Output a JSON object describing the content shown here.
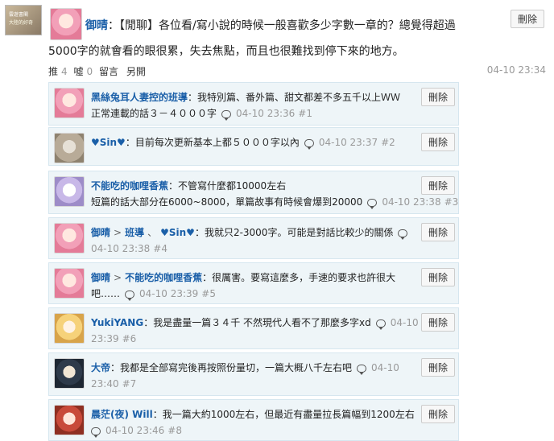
{
  "post": {
    "thumb_line1": "雲遊書閣",
    "thumb_line2": "大陸的好奇",
    "author": "御晴",
    "text1": "：【閒聊】各位看/寫小說的時候一般喜歡多少字數一章的？總覺得超過",
    "text2": "5000字的就會看的眼很累，失去焦點，而且也很難找到停下來的地方。",
    "push_label": "推",
    "push_count": "4",
    "boo_label": "噓",
    "boo_count": "0",
    "comment_label": "留言",
    "reply_label": "另開",
    "time": "04-10 23:34",
    "delete_label": "刪除"
  },
  "replies": [
    {
      "author": "黑絲兔耳人妻控的班導",
      "text": "：我特別篇、番外篇、甜文都差不多五千以上ＷＷ",
      "text2": "正常連載的話３－４０００字",
      "time": "04-10 23:36",
      "floor": "#1",
      "delete": "刪除"
    },
    {
      "author": "♥Sin♥",
      "text": "：目前每次更新基本上都５０００字以內",
      "time": "04-10 23:37",
      "floor": "#2",
      "delete": "刪除"
    },
    {
      "author": "不能吃的咖哩香蕉",
      "text": "：不管寫什麼都10000左右",
      "text2": "短篇的話大部分在6000~8000，單篇故事有時候會爆到20000",
      "time": "04-10 23:38",
      "floor": "#3",
      "delete": "刪除"
    },
    {
      "author": "御晴",
      "sep": ">",
      "to1": "班導",
      "to2": "♥Sin♥",
      "text": "：我就只2-3000字。可能是對話比較少的關係",
      "time": "04-10 23:38",
      "floor": "#4",
      "delete": "刪除"
    },
    {
      "author": "御晴",
      "sep": ">",
      "to1": "不能吃的咖哩香蕉",
      "text": "：很厲害。要寫這麼多，手速的要求也許很大",
      "text2": "吧……",
      "time": "04-10 23:39",
      "floor": "#5",
      "delete": "刪除"
    },
    {
      "author": "YukiYANG",
      "text": "：我是盡量一篇３４千 不然現代人看不了那麼多字xd",
      "time_a": "04-10",
      "time_b": "23:39",
      "floor": "#6",
      "delete": "刪除"
    },
    {
      "author": "大帝",
      "text": "：我都是全部寫完後再按照份量切，一篇大概八千左右吧",
      "time_a": "04-10",
      "time_b": "23:40",
      "floor": "#7",
      "delete": "刪除"
    },
    {
      "author": "晨茫(夜) Will",
      "text": "：我一篇大約1000左右，但最近有盡量拉長篇幅到1200左右",
      "time": "04-10 23:46",
      "floor": "#8",
      "delete": "刪除"
    }
  ]
}
